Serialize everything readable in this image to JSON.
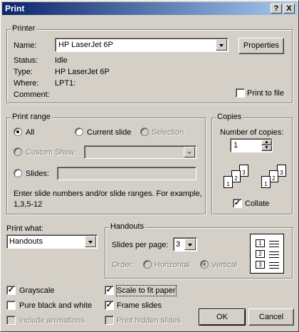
{
  "window": {
    "title": "Print",
    "help": "?",
    "close": "X"
  },
  "printer": {
    "group": "Printer",
    "name_label": "Name:",
    "name_value": "HP LaserJet 6P",
    "properties": "Properties",
    "status_label": "Status:",
    "status_value": "Idle",
    "type_label": "Type:",
    "type_value": "HP LaserJet 6P",
    "where_label": "Where:",
    "where_value": "LPT1:",
    "comment_label": "Comment:",
    "print_to_file": "Print to file"
  },
  "range": {
    "group": "Print range",
    "all": "All",
    "current": "Current slide",
    "selection": "Selection",
    "custom": "Custom Show:",
    "slides": "Slides:",
    "hint1": "Enter slide numbers and/or slide ranges. For example,",
    "hint2": "1,3,5-12"
  },
  "copies": {
    "group": "Copies",
    "number_label": "Number of copies:",
    "number_value": "1",
    "collate": "Collate",
    "page_numbers": [
      "1",
      "2",
      "3",
      "1",
      "2",
      "3"
    ]
  },
  "print_what": {
    "label": "Print what:",
    "value": "Handouts"
  },
  "handouts": {
    "group": "Handouts",
    "per_page_label": "Slides per page:",
    "per_page_value": "3",
    "order_label": "Order:",
    "horizontal": "Horizontal",
    "vertical": "Vertical",
    "preview_numbers": [
      "1",
      "2",
      "3"
    ]
  },
  "options": {
    "grayscale": "Grayscale",
    "pure_bw": "Pure black and white",
    "include_anim": "Include animations",
    "scale": "Scale to fit paper",
    "frame": "Frame slides",
    "hidden": "Print hidden slides"
  },
  "buttons": {
    "ok": "OK",
    "cancel": "Cancel"
  }
}
